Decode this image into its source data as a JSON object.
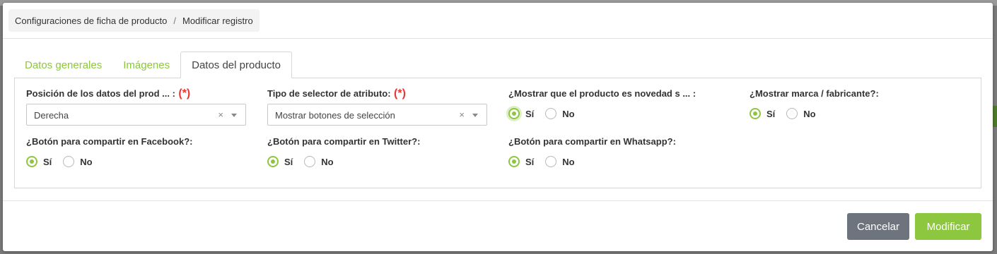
{
  "breadcrumb": {
    "parent": "Configuraciones de ficha de producto",
    "separator": "/",
    "current": "Modificar registro"
  },
  "tabs": [
    {
      "label": "Datos generales",
      "active": false
    },
    {
      "label": "Imágenes",
      "active": false
    },
    {
      "label": "Datos del producto",
      "active": true
    }
  ],
  "required_mark": "(*)",
  "fields": {
    "posicion": {
      "label": "Posición de los datos del prod ... :",
      "value": "Derecha",
      "clear": "×"
    },
    "selector": {
      "label": "Tipo de selector de atributo:",
      "value": "Mostrar botones de selección",
      "clear": "×"
    },
    "novedad": {
      "label": "¿Mostrar que el producto es novedad s ... :",
      "selected": "Sí"
    },
    "marca": {
      "label": "¿Mostrar marca / fabricante?:",
      "selected": "Sí"
    },
    "facebook": {
      "label": "¿Botón para compartir en Facebook?:",
      "selected": "Sí"
    },
    "twitter": {
      "label": "¿Botón para compartir en Twitter?:",
      "selected": "Sí"
    },
    "whatsapp": {
      "label": "¿Botón para compartir en Whatsapp?:",
      "selected": "Sí"
    }
  },
  "options": {
    "yes": "Sí",
    "no": "No"
  },
  "buttons": {
    "cancel": "Cancelar",
    "submit": "Modificar"
  },
  "colors": {
    "accent": "#8dc63f",
    "required": "#e53935",
    "cancel_bg": "#6d747d"
  }
}
